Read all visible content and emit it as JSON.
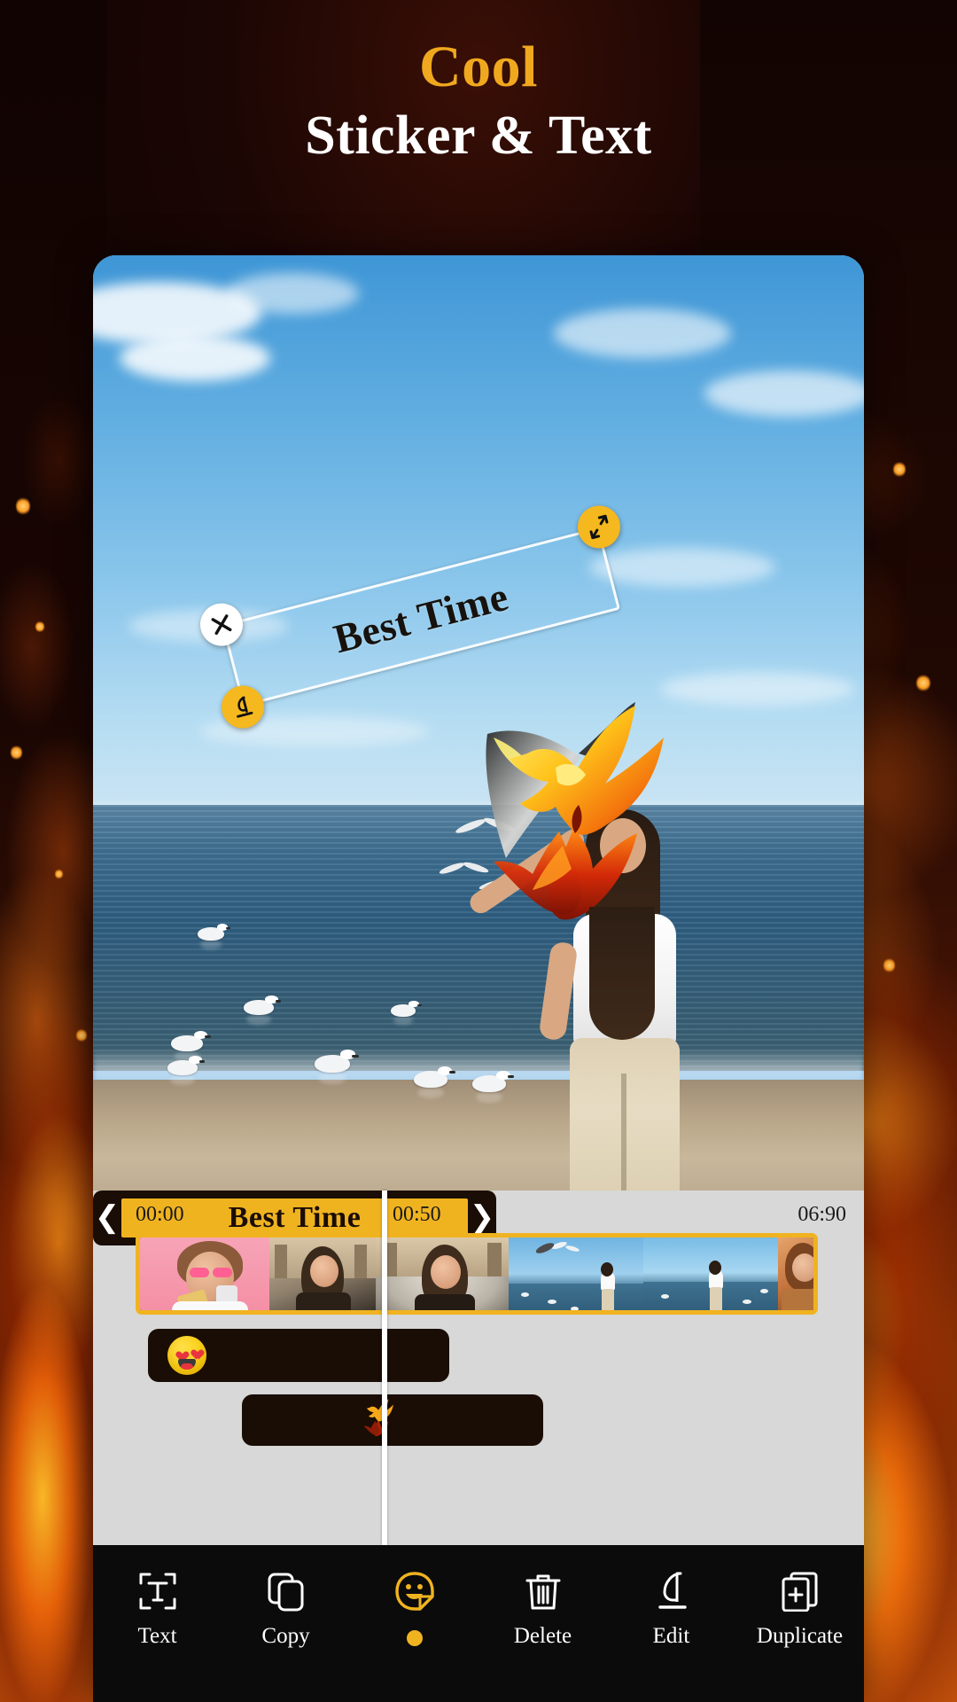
{
  "headline": {
    "line1": "Cool",
    "line2": "Sticker & Text"
  },
  "colors": {
    "accent_gold": "#f0b320",
    "headline_gold": "#f0a81e",
    "panel_gray": "#d8d8d8",
    "layer_dark": "#1a0d05",
    "toolbar_black": "#0b0b0b",
    "selection_white": "#ffffff"
  },
  "canvas": {
    "text_sticker": {
      "text": "Best Time",
      "rotation_deg": -14.5,
      "handles": {
        "close": "close-icon",
        "edit": "pencil-icon",
        "resize": "resize-diagonal-icon"
      }
    },
    "stickers": [
      {
        "name": "heart-eyes-emoji-sticker",
        "label": "Heart Eyes Emoji"
      },
      {
        "name": "phoenix-sticker",
        "label": "Phoenix"
      }
    ]
  },
  "timeline": {
    "ruler": {
      "start": "00:00",
      "middle": "00:50",
      "end": "06:90"
    },
    "clips": [
      "clip-thumb-1",
      "clip-thumb-2",
      "clip-thumb-3",
      "clip-thumb-4",
      "clip-thumb-5",
      "clip-thumb-6"
    ],
    "layers": [
      {
        "name": "emoji-layer",
        "type": "sticker",
        "icon": "heart-eyes-emoji"
      },
      {
        "name": "phoenix-layer",
        "type": "sticker",
        "icon": "phoenix"
      },
      {
        "name": "text-layer",
        "type": "text",
        "label": "Best Time",
        "selected": true,
        "left_handle": "❮",
        "right_handle": "❯"
      }
    ]
  },
  "toolbar": {
    "items": [
      {
        "id": "text",
        "label": "Text",
        "icon": "text-frame-icon",
        "active": false
      },
      {
        "id": "copy",
        "label": "Copy",
        "icon": "copy-icon",
        "active": false
      },
      {
        "id": "sticker",
        "label": "",
        "icon": "sticker-face-icon",
        "active": true
      },
      {
        "id": "delete",
        "label": "Delete",
        "icon": "trash-icon",
        "active": false
      },
      {
        "id": "edit",
        "label": "Edit",
        "icon": "pencil-icon",
        "active": false
      },
      {
        "id": "duplicate",
        "label": "Duplicate",
        "icon": "duplicate-icon",
        "active": false
      }
    ]
  }
}
